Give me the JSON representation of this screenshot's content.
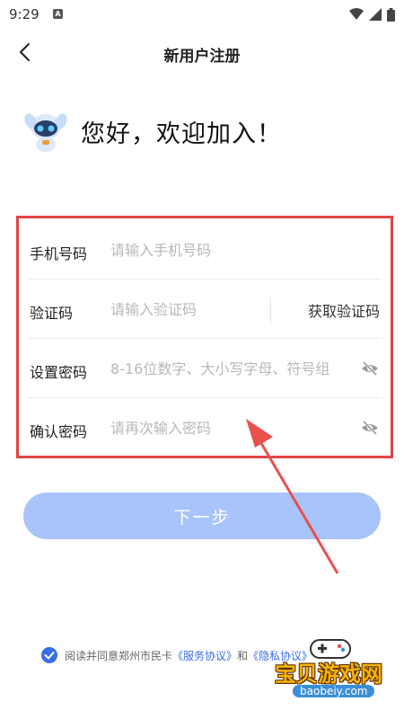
{
  "status_bar": {
    "time": "9:29",
    "notification_badge": "A",
    "icons": [
      "wifi-icon",
      "signal-icon",
      "battery-icon"
    ]
  },
  "header": {
    "title": "新用户注册",
    "back_icon": "chevron-left-icon"
  },
  "greeting": {
    "text": "您好，欢迎加入！",
    "mascot_icon": "robot-mascot-icon"
  },
  "form": {
    "phone": {
      "label": "手机号码",
      "placeholder": "请输入手机号码",
      "value": ""
    },
    "code": {
      "label": "验证码",
      "placeholder": "请输入验证码",
      "value": "",
      "button_label": "获取验证码"
    },
    "password": {
      "label": "设置密码",
      "placeholder": "8-16位数字、大小写字母、符号组",
      "value": "",
      "toggle_icon": "eye-hidden-icon"
    },
    "confirm": {
      "label": "确认密码",
      "placeholder": "请再次输入密码",
      "value": "",
      "toggle_icon": "eye-hidden-icon"
    }
  },
  "next_button": {
    "label": "下一步"
  },
  "agreement": {
    "checked": true,
    "prefix": "阅读并同意郑州市民卡",
    "link1": "《服务协议》",
    "conjunction": "和",
    "link2": "《隐私协议》"
  },
  "watermark": {
    "text": "宝贝游戏网",
    "url": "baobeiy.com"
  },
  "colors": {
    "primary_button": "#a9c4fb",
    "link": "#3b6fe6",
    "highlight_border": "#e14545",
    "checkbox": "#3b6fe6"
  }
}
